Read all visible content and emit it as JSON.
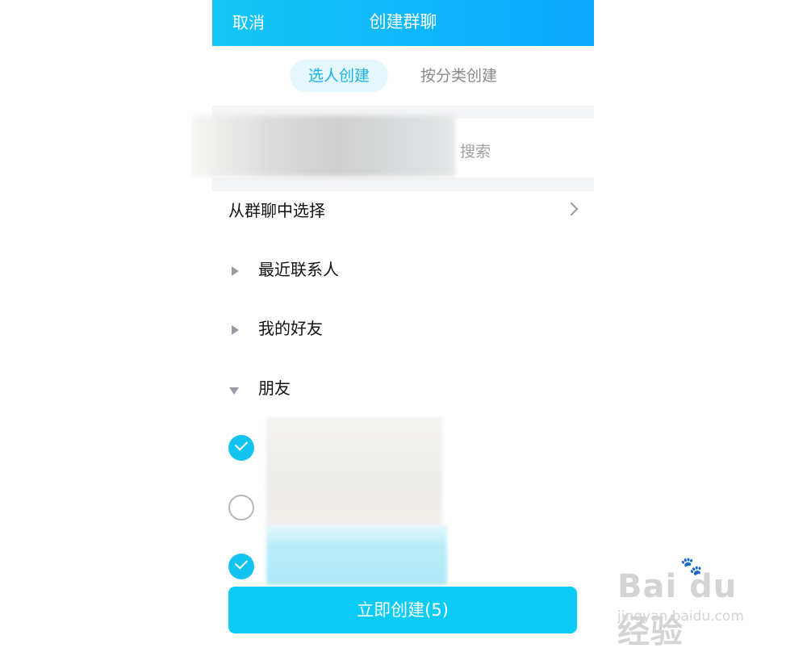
{
  "header": {
    "cancel": "取消",
    "title": "创建群聊"
  },
  "tabs": [
    {
      "label": "选人创建",
      "active": true
    },
    {
      "label": "按分类创建",
      "active": false
    }
  ],
  "search": {
    "placeholder": "搜索"
  },
  "list": {
    "from_group": "从群聊中选择",
    "sections": [
      {
        "label": "最近联系人",
        "expanded": false
      },
      {
        "label": "我的好友",
        "expanded": false
      },
      {
        "label": "朋友",
        "expanded": true
      }
    ]
  },
  "members": [
    {
      "checked": true
    },
    {
      "checked": false
    },
    {
      "checked": true
    }
  ],
  "create_button": "立即创建(5)",
  "watermark": {
    "brand": "Bai du 经验",
    "url": "jingyan.baidu.com"
  },
  "colors": {
    "header_start": "#14c6f5",
    "header_end": "#0aa9ff",
    "accent": "#0acbf6",
    "check": "#12c3f0"
  }
}
